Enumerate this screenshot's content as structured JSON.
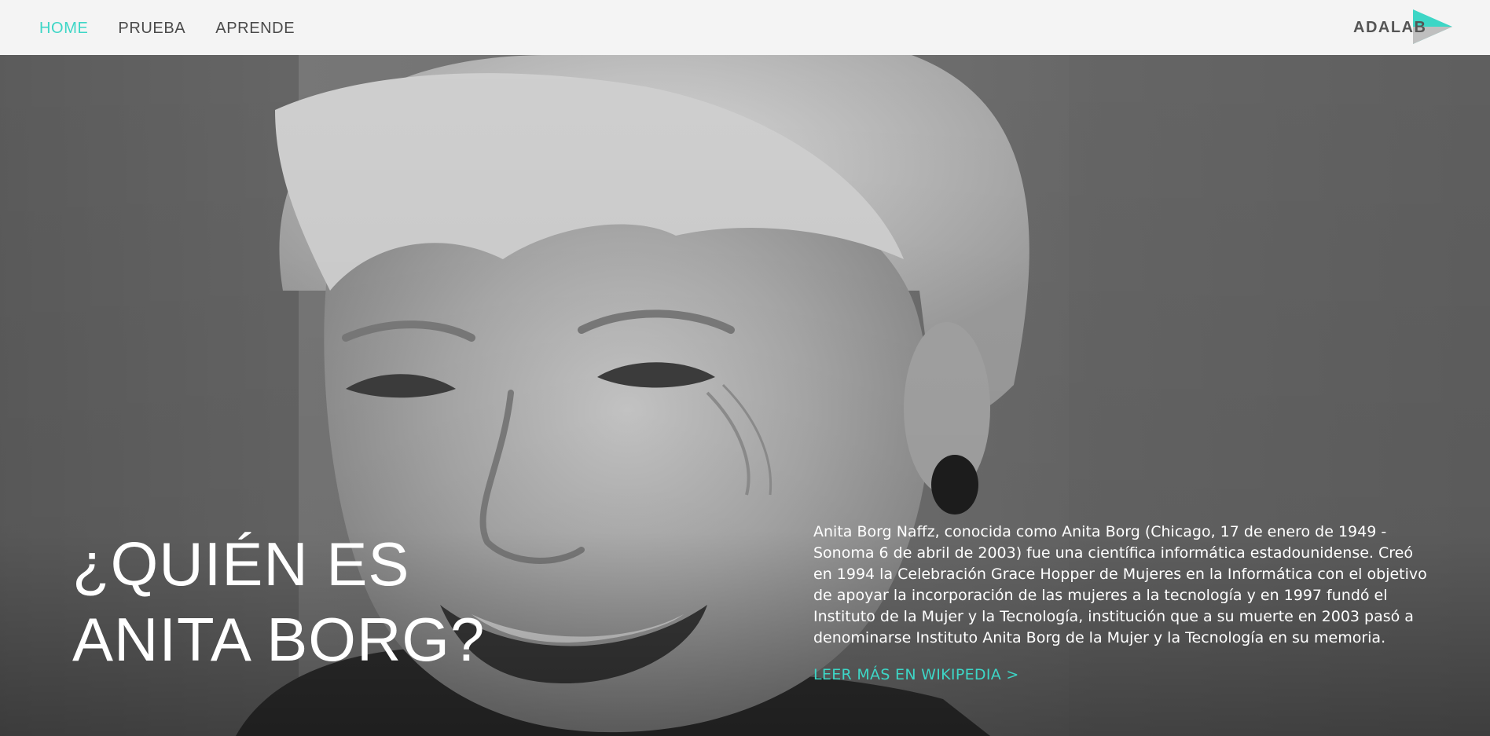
{
  "nav": {
    "items": [
      {
        "label": "HOME",
        "active": true
      },
      {
        "label": "PRUEBA",
        "active": false
      },
      {
        "label": "APRENDE",
        "active": false
      }
    ]
  },
  "logo": {
    "text": "ADALAB",
    "icon": "play-triangle-icon"
  },
  "hero": {
    "title_line1": "¿QUIÉN ES",
    "title_line2": "ANITA BORG?",
    "bio": "Anita Borg Naffz, conocida como Anita Borg (Chicago, 17 de enero de 1949 - Sonoma 6 de abril de 2003) fue una científica informática estadounidense. Creó en 1994 la Celebración Grace Hopper de Mujeres en la Informática con el objetivo de apoyar la incorporación de las mujeres a la tecnología y en 1997 fundó el Instituto de la Mujer y la Tecnología, institución que a su muerte en 2003 pasó a denominarse Instituto Anita Borg de la Mujer y la Tecnología en su memoria.",
    "read_more": "LEER MÁS EN WIKIPEDIA >"
  },
  "colors": {
    "accent": "#3dd6c6",
    "nav_text": "#4a4a4a",
    "bar_bg": "#f4f4f4"
  }
}
